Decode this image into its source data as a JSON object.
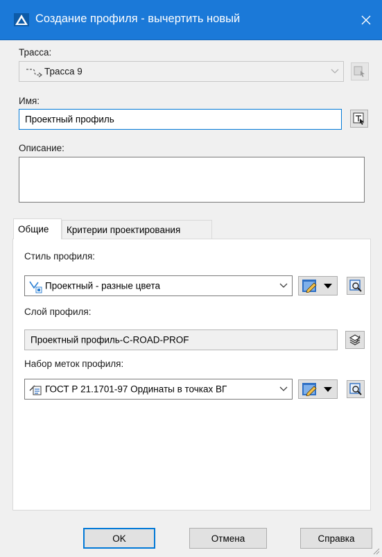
{
  "dialog": {
    "title": "Создание профиля - вычертить новый",
    "close_glyph": "✕"
  },
  "alignment": {
    "label": "Трасса:",
    "value": "Трасса 9",
    "icon": "alignment-icon",
    "pick_icon": "pick-from-drawing-icon"
  },
  "name": {
    "label": "Имя:",
    "value": "Проектный профиль",
    "editor_icon": "name-template-icon"
  },
  "description": {
    "label": "Описание:",
    "value": ""
  },
  "tabs": [
    {
      "label": "Общие",
      "active": true
    },
    {
      "label": "Критерии проектирования",
      "active": false
    }
  ],
  "general": {
    "style_label": "Стиль профиля:",
    "style_value": "Проектный - разные цвета",
    "style_icon": "profile-style-icon",
    "layer_label": "Слой профиля:",
    "layer_value": "Проектный профиль-C-ROAD-PROF",
    "layer_icon": "layers-icon",
    "labelset_label": "Набор меток профиля:",
    "labelset_value": "ГОСТ Р 21.1701-97 Ординаты в точках ВГ",
    "labelset_icon": "label-set-icon"
  },
  "buttons": {
    "ok": "OK",
    "cancel": "Отмена",
    "help": "Справка"
  },
  "colors": {
    "titlebar": "#1b79d8",
    "focus": "#0078d7",
    "dialog_bg": "#f0f0f0"
  }
}
